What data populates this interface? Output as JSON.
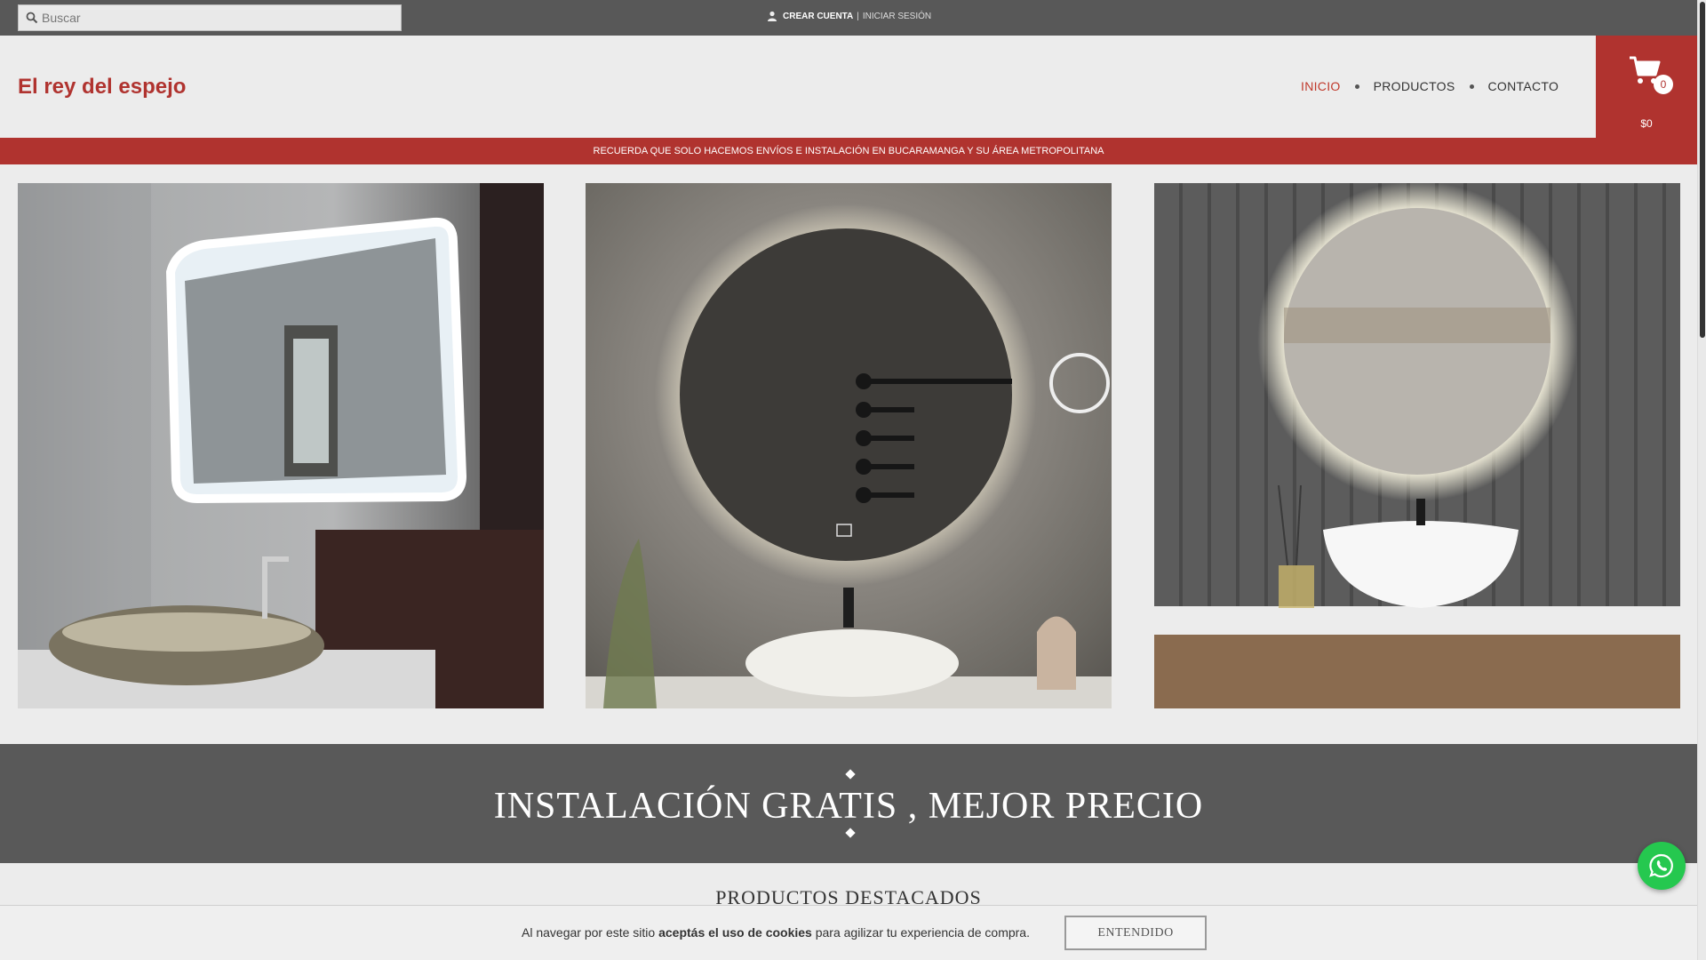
{
  "topbar": {
    "search_placeholder": "Buscar",
    "create_account": "CREAR CUENTA",
    "separator": "|",
    "login": "INICIAR SESIÓN"
  },
  "header": {
    "logo": "El rey del espejo",
    "nav": [
      {
        "label": "INICIO",
        "active": true
      },
      {
        "label": "PRODUCTOS",
        "active": false
      },
      {
        "label": "CONTACTO",
        "active": false
      }
    ],
    "cart": {
      "count": "0",
      "total": "$0"
    }
  },
  "announcement": "RECUERDA QUE SOLO HACEMOS ENVÍOS E INSTALACIÓN EN BUCARAMANGA Y SU ÁREA METROPOLITANA",
  "promo": {
    "title": "INSTALACIÓN GRATIS , MEJOR PRECIO"
  },
  "featured": {
    "title": "PRODUCTOS DESTACADOS"
  },
  "cookie": {
    "text_before": "Al navegar por este sitio ",
    "text_bold": "aceptás el uso de cookies",
    "text_after": " para agilizar tu experiencia de compra.",
    "button": "ENTENDIDO"
  },
  "colors": {
    "brand": "#b0332f",
    "topbar": "#585858",
    "whatsapp": "#25c84f"
  },
  "icons": [
    "search-icon",
    "user-icon",
    "cart-icon",
    "whatsapp-icon"
  ]
}
